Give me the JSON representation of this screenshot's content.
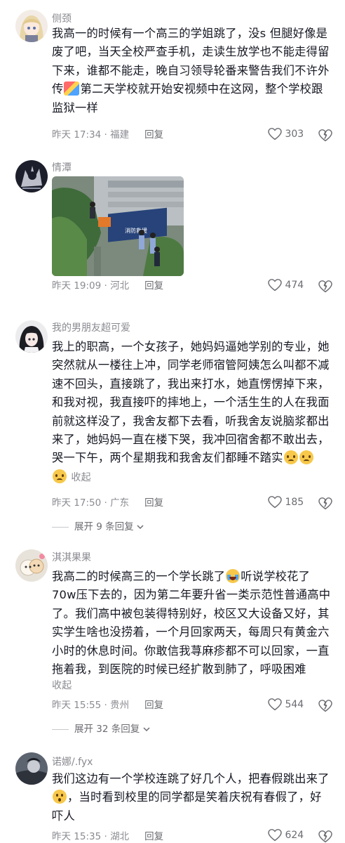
{
  "comments": [
    {
      "username": "侧颈",
      "lines": [
        "我高一的时候有一个高三的学姐跳了，没s 但腿好像是",
        "废了吧，当天全校严查手机，走读生放学也不能走得留",
        "下来，谁都不能走，晚自习领导轮番来警告我们不许外",
        "第二天学校就开始安视频中在这网，整个学校跟",
        "监狱一样"
      ],
      "line4_prefix": "传",
      "time": "昨天 17:34 · 福建",
      "reply": "回复",
      "likes": "303"
    },
    {
      "username": "情潭",
      "photo_caption": "消防救援",
      "time": "昨天 19:09 · 河北",
      "reply": "回复",
      "likes": "474"
    },
    {
      "username": "我的男朋友超可爱",
      "lines": [
        "我上的职高，一个女孩子，她妈妈逼她学别的专业，她",
        "突然就从一楼往上冲，同学老师宿管阿姨怎么叫都不减",
        "速不回头，直接跳了，我出来打水，她直愣愣掉下来，",
        "和我对视，我直接吓的摔地上，一个活生生的人在我面",
        "前就这样没了，我舍友都下去看，听我舍友说脑浆都出",
        "来了，她妈妈一直在楼下哭，我冲回宿舍都不敢出去，",
        "哭一下午，两个星期我和我舍友们都睡不踏实"
      ],
      "collapse": "收起",
      "time": "昨天 17:50 · 广东",
      "reply": "回复",
      "likes": "185",
      "expand": "展开 9 条回复"
    },
    {
      "username": "淇淇果果",
      "lines": [
        "我高二的时候高三的一个学长跳了",
        "70w压下去的，因为第二年要升省一类示范性普通高中",
        "了。我们高中被包装得特别好，校区又大设备又好，其",
        "实学生啥也没捞着，一个月回家两天，每周只有黄金六",
        "小时的休息时间。你敢信我荨麻疹都不可以回家，一直",
        "拖着我，到医院的时候已经扩散到肺了，呼吸困难"
      ],
      "line1_suffix": "听说学校花了",
      "collapse": "收起",
      "time": "昨天 15:55 · 贵州",
      "reply": "回复",
      "likes": "544",
      "expand": "展开 32 条回复"
    },
    {
      "username": "诺娜/.fyx",
      "lines": [
        "我们这边有一个学校连跳了好几个人，把春假跳出来了",
        "，当时看到校里的同学都是笑着庆祝有春假了，好",
        "吓人"
      ],
      "time": "昨天 15:35 · 湖北",
      "reply": "回复",
      "likes": "624"
    }
  ]
}
